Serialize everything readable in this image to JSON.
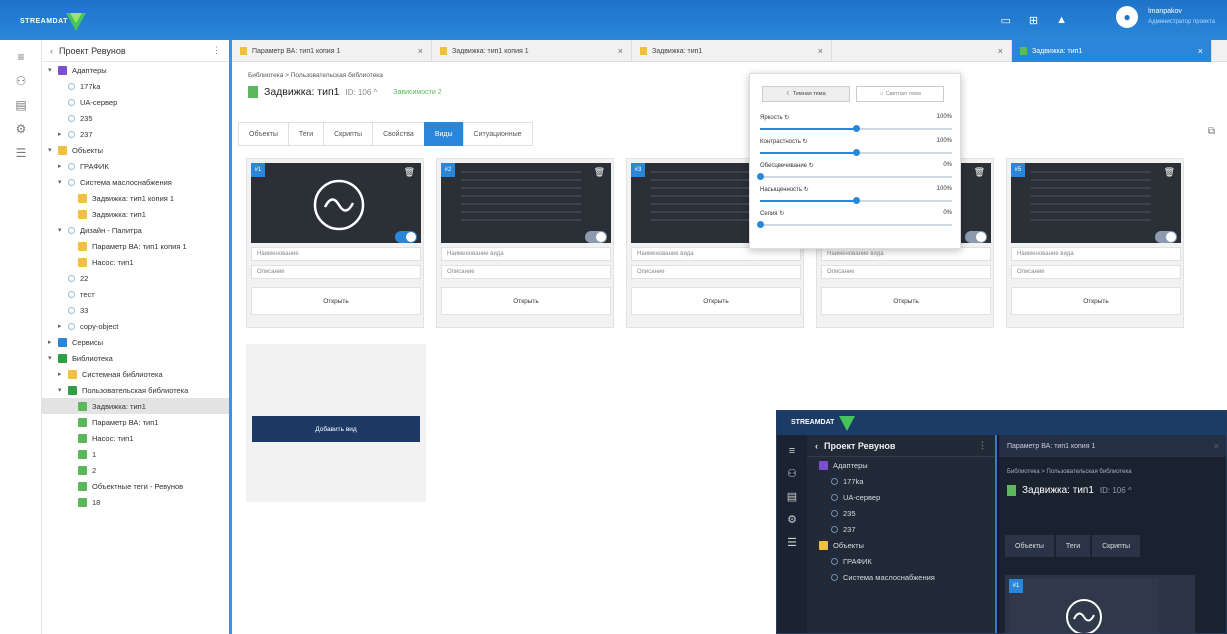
{
  "header": {
    "logo_text": "STREAMDAT",
    "user_name": "lmanpakov",
    "user_role": "Администратор проекта"
  },
  "rail_icons": [
    "menu-icon",
    "hierarchy-icon",
    "document-icon",
    "gear-icon",
    "list-icon"
  ],
  "tree": {
    "title": "Проект Ревунов",
    "nodes": [
      {
        "label": "Адаптеры",
        "depth": 0,
        "icon": "#7b4fd0",
        "arrow": "▾"
      },
      {
        "label": "177ka",
        "depth": 1,
        "icon": "",
        "arrow": ""
      },
      {
        "label": "UA-сервер",
        "depth": 1,
        "icon": "",
        "arrow": ""
      },
      {
        "label": "235",
        "depth": 1,
        "icon": "",
        "arrow": ""
      },
      {
        "label": "237",
        "depth": 1,
        "icon": "",
        "arrow": "▸"
      },
      {
        "label": "Объекты",
        "depth": 0,
        "icon": "#f0c040",
        "arrow": "▾"
      },
      {
        "label": "ГРАФИК",
        "depth": 1,
        "icon": "",
        "arrow": "▸"
      },
      {
        "label": "Система маслоснабжения",
        "depth": 1,
        "icon": "",
        "arrow": "▾"
      },
      {
        "label": "Задвижка: тип1 копия 1",
        "depth": 2,
        "icon": "#f0c040",
        "arrow": ""
      },
      {
        "label": "Задвижка: тип1",
        "depth": 2,
        "icon": "#f0c040",
        "arrow": ""
      },
      {
        "label": "Дизайн - Палитра",
        "depth": 1,
        "icon": "",
        "arrow": "▾"
      },
      {
        "label": "Параметр ВА: тип1 копия 1",
        "depth": 2,
        "icon": "#f0c040",
        "arrow": ""
      },
      {
        "label": "Насос: тип1",
        "depth": 2,
        "icon": "#f0c040",
        "arrow": ""
      },
      {
        "label": "22",
        "depth": 1,
        "icon": "",
        "arrow": ""
      },
      {
        "label": "тест",
        "depth": 1,
        "icon": "",
        "arrow": ""
      },
      {
        "label": "33",
        "depth": 1,
        "icon": "",
        "arrow": ""
      },
      {
        "label": "copy-object",
        "depth": 1,
        "icon": "",
        "arrow": "▸"
      },
      {
        "label": "Сервисы",
        "depth": 0,
        "icon": "#2a86d8",
        "arrow": "▸"
      },
      {
        "label": "Библиотека",
        "depth": 0,
        "icon": "#2e9e47",
        "arrow": "▾"
      },
      {
        "label": "Системная библиотека",
        "depth": 1,
        "icon": "#f0c040",
        "arrow": "▸"
      },
      {
        "label": "Пользовательская библиотека",
        "depth": 1,
        "icon": "#2e9e47",
        "arrow": "▾"
      },
      {
        "label": "Задвижка: тип1",
        "depth": 2,
        "icon": "#5cb85c",
        "arrow": "",
        "selected": true
      },
      {
        "label": "Параметр ВА: тип1",
        "depth": 2,
        "icon": "#5cb85c",
        "arrow": ""
      },
      {
        "label": "Насос: тип1",
        "depth": 2,
        "icon": "#5cb85c",
        "arrow": ""
      },
      {
        "label": "1",
        "depth": 2,
        "icon": "#5cb85c",
        "arrow": ""
      },
      {
        "label": "2",
        "depth": 2,
        "icon": "#5cb85c",
        "arrow": ""
      },
      {
        "label": "Объектные теги - Ревунов",
        "depth": 2,
        "icon": "#5cb85c",
        "arrow": ""
      },
      {
        "label": "18",
        "depth": 2,
        "icon": "#5cb85c",
        "arrow": ""
      }
    ]
  },
  "tabs": [
    {
      "label": "Параметр ВА: тип1 копия 1",
      "active": false
    },
    {
      "label": "Задвижка: тип1 копия 1",
      "active": false
    },
    {
      "label": "Задвижка: тип1",
      "active": false
    },
    {
      "label": "",
      "active": false
    },
    {
      "label": "Задвижка: тип1",
      "active": true
    }
  ],
  "content": {
    "breadcrumb": "Библиотека > Пользовательская библиотека",
    "title": "Задвижка: тип1",
    "id_text": "ID: 106 ^",
    "dependencies": "Зависимости 2",
    "subtabs": [
      "Объекты",
      "Теги",
      "Скрипты",
      "Свойства",
      "Виды",
      "Ситуационные"
    ],
    "active_subtab": 4
  },
  "cards": [
    {
      "num": "#1",
      "name_placeholder": "Наименование",
      "desc_placeholder": "Описание",
      "open": "Открыть",
      "toggle_on": true
    },
    {
      "num": "#2",
      "name_placeholder": "Наименование вида",
      "desc_placeholder": "Описание",
      "open": "Открыть",
      "toggle_on": false
    },
    {
      "num": "#3",
      "name_placeholder": "Наименование вида",
      "desc_placeholder": "Описание",
      "open": "Открыть",
      "toggle_on": false
    },
    {
      "num": "#4",
      "name_placeholder": "Наименование вида",
      "desc_placeholder": "Описание",
      "open": "Открыть",
      "toggle_on": false
    },
    {
      "num": "#5",
      "name_placeholder": "Наименование вида",
      "desc_placeholder": "Описание",
      "open": "Открыть",
      "toggle_on": false
    }
  ],
  "add_view_label": "Добавить вид",
  "panel": {
    "dark_theme_label": "Темная тема",
    "light_theme_label": "Светлая тема",
    "sliders": [
      {
        "label": "Яркость",
        "value_text": "100%",
        "fraction": 0.5
      },
      {
        "label": "Контрастность",
        "value_text": "100%",
        "fraction": 0.5
      },
      {
        "label": "Обесцвечивание",
        "value_text": "0%",
        "fraction": 0.0
      },
      {
        "label": "Насыщенность",
        "value_text": "100%",
        "fraction": 0.5
      },
      {
        "label": "Сепия",
        "value_text": "0%",
        "fraction": 0.0
      }
    ]
  },
  "dark_preview": {
    "logo_text": "STREAMDAT",
    "tree_title": "Проект Ревунов",
    "nodes": [
      "Адаптеры",
      "177ka",
      "UA-сервер",
      "235",
      "237",
      "Объекты",
      "ГРАФИК",
      "Система маслоснабжения"
    ],
    "tab": "Параметр ВА: тип1 копия 1",
    "breadcrumb": "Библиотека > Пользовательская библиотека",
    "title": "Задвижка: тип1",
    "id_text": "ID: 106 ^",
    "subtabs": [
      "Объекты",
      "Теги",
      "Скрипты"
    ]
  }
}
